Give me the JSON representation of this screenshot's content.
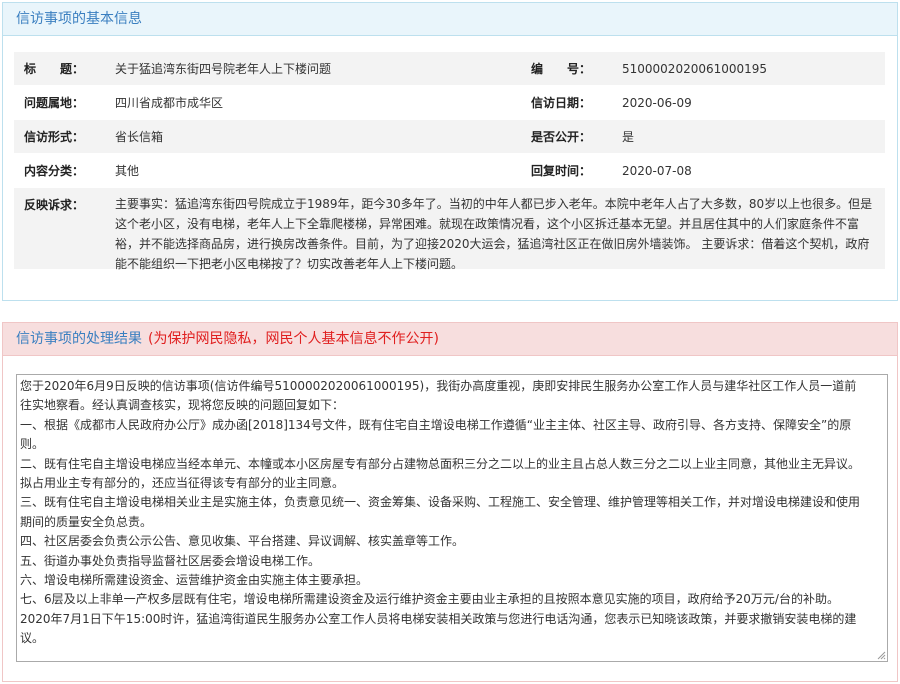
{
  "basic_info": {
    "section_title": "信访事项的基本信息",
    "title_label": "标　　题：",
    "title_value": "关于猛追湾东街四号院老年人上下楼问题",
    "number_label": "编　　号：",
    "number_value": "5100002020061000195",
    "location_label": "问题属地：",
    "location_value": "四川省成都市成华区",
    "date_label": "信访日期：",
    "date_value": "2020-06-09",
    "form_label": "信访形式：",
    "form_value": "省长信箱",
    "public_label": "是否公开：",
    "public_value": "是",
    "category_label": "内容分类：",
    "category_value": "其他",
    "reply_time_label": "回复时间：",
    "reply_time_value": "2020-07-08",
    "appeal_label": "反映诉求：",
    "appeal_value": "主要事实：猛追湾东街四号院成立于1989年，距今30多年了。当初的中年人都已步入老年。本院中老年人占了大多数，80岁以上也很多。但是这个老小区，没有电梯，老年人上下全靠爬楼梯，异常困难。就现在政策情况看，这个小区拆迁基本无望。并且居住其中的人们家庭条件不富裕，并不能选择商品房，进行换房改善条件。目前，为了迎接2020大运会，猛追湾社区正在做旧房外墙装饰。 主要诉求：借着这个契机，政府能不能组织一下把老小区电梯按了？切实改善老年人上下楼问题。"
  },
  "result": {
    "section_title": "信访事项的处理结果",
    "privacy_note": "(为保护网民隐私，网民个人基本信息不作公开)",
    "paragraphs": [
      "您于2020年6月9日反映的信访事项(信访件编号5100002020061000195)，我街办高度重视，庚即安排民生服务办公室工作人员与建华社区工作人员一道前往实地察看。经认真调查核实，现将您反映的问题回复如下：",
      "一、根据《成都市人民政府办公厅》成办函[2018]134号文件，既有住宅自主增设电梯工作遵循“业主主体、社区主导、政府引导、各方支持、保障安全”的原则。",
      "二、既有住宅自主增设电梯应当经本单元、本幢或本小区房屋专有部分占建物总面积三分之二以上的业主且占总人数三分之二以上业主同意，其他业主无异议。拟占用业主专有部分的，还应当征得该专有部分的业主同意。",
      "三、既有住宅自主增设电梯相关业主是实施主体，负责意见统一、资金筹集、设备采购、工程施工、安全管理、维护管理等相关工作，并对增设电梯建设和使用期间的质量安全负总责。",
      "四、社区居委会负责公示公告、意见收集、平台搭建、异议调解、核实盖章等工作。",
      "五、街道办事处负责指导监督社区居委会增设电梯工作。",
      "六、增设电梯所需建设资金、运营维护资金由实施主体主要承担。",
      "七、6层及以上非单一产权多层既有住宅，增设电梯所需建设资金及运行维护资金主要由业主承担的且按照本意见实施的项目，政府给予20万元/台的补助。",
      "2020年7月1日下午15:00时许，猛追湾街道民生服务办公室工作人员将电梯安装相关政策与您进行电话沟通，您表示已知晓该政策，并要求撤销安装电梯的建议。"
    ]
  },
  "colors": {
    "info_header_bg": "#e9f5fb",
    "result_header_bg": "#f7dede",
    "heading_blue": "#3a7fc0",
    "note_red": "#e02020"
  }
}
